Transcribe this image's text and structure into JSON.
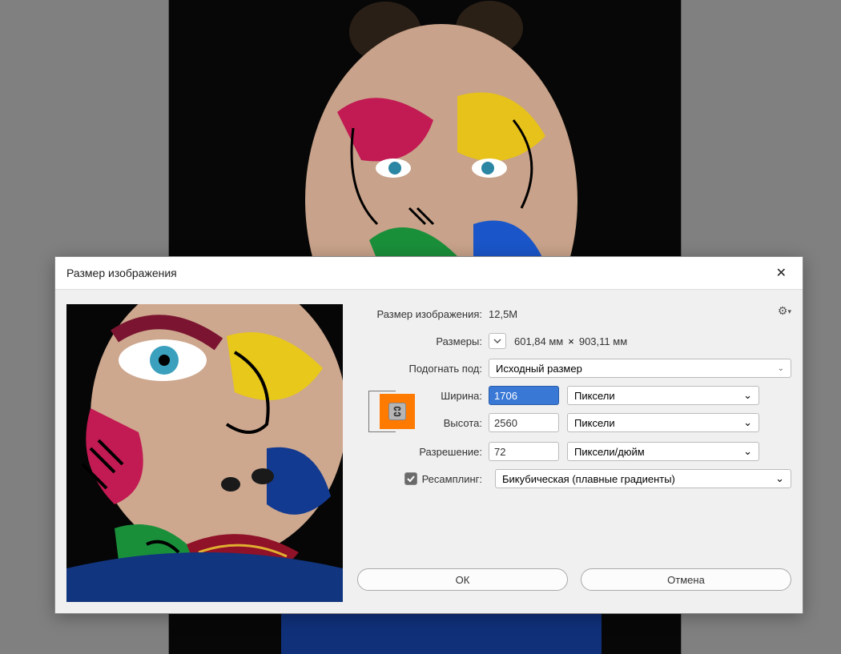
{
  "dialog": {
    "title": "Размер изображения",
    "image_size_label": "Размер изображения:",
    "image_size_value": "12,5M",
    "dimensions_label": "Размеры:",
    "dimensions_value_w": "601,84 мм",
    "dimensions_value_h": "903,11 мм",
    "fit_label": "Подогнать под:",
    "fit_value": "Исходный размер",
    "width_label": "Ширина:",
    "width_value": "1706",
    "width_unit": "Пиксели",
    "height_label": "Высота:",
    "height_value": "2560",
    "height_unit": "Пиксели",
    "resolution_label": "Разрешение:",
    "resolution_value": "72",
    "resolution_unit": "Пиксели/дюйм",
    "resample_label": "Ресамплинг:",
    "resample_value": "Бикубическая (плавные градиенты)",
    "ok_label": "ОК",
    "cancel_label": "Отмена"
  }
}
